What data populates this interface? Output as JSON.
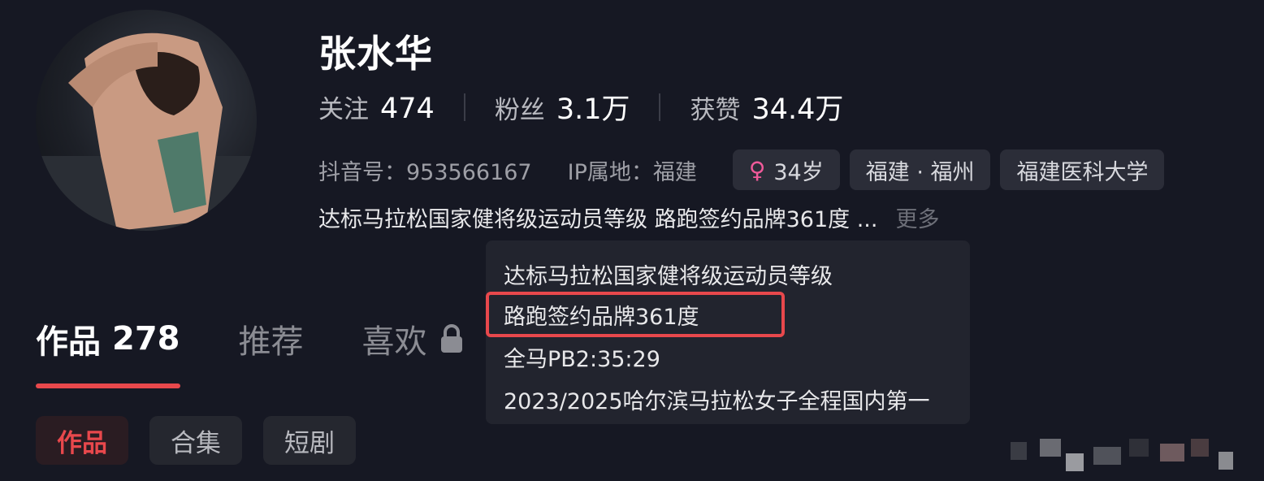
{
  "profile": {
    "name": "张水华",
    "stats": [
      {
        "label": "关注",
        "value": "474"
      },
      {
        "label": "粉丝",
        "value": "3.1万"
      },
      {
        "label": "获赞",
        "value": "34.4万"
      }
    ],
    "douyin_id": "抖音号：953566167",
    "ip_location": "IP属地：福建",
    "tags": {
      "age": "34岁",
      "region": "福建 · 福州",
      "school": "福建医科大学"
    },
    "bio_preview": "达标马拉松国家健将级运动员等级 路跑签约品牌361度 ...",
    "more_label": "更多"
  },
  "bio_popup": {
    "lines": [
      "达标马拉松国家健将级运动员等级",
      "路跑签约品牌361度",
      "全马PB2:35:29",
      "2023/2025哈尔滨马拉松女子全程国内第一"
    ]
  },
  "tabs": {
    "works_label": "作品",
    "works_count": "278",
    "recommend_label": "推荐",
    "likes_label": "喜欢"
  },
  "subtabs": [
    "作品",
    "合集",
    "短剧"
  ],
  "colors": {
    "accent": "#e8484c",
    "background": "#161823",
    "female": "#f05a9a"
  },
  "icons": {
    "gender": "female-icon",
    "lock": "lock-icon"
  }
}
